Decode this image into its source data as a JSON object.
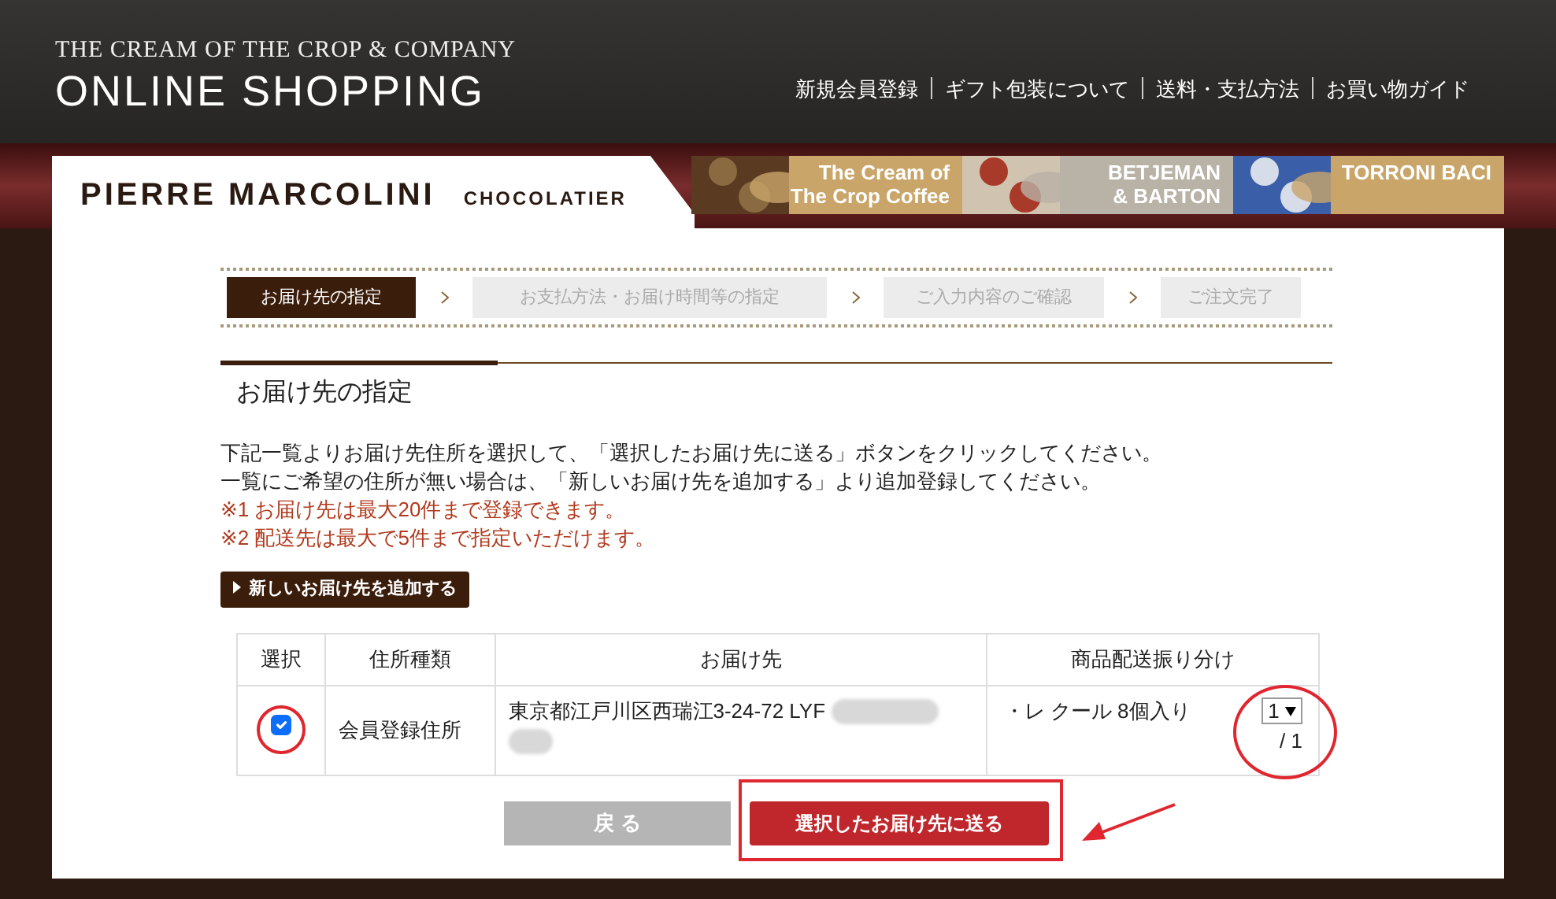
{
  "header": {
    "brand_line": "THE CREAM OF THE CROP & COMPANY",
    "title": "ONLINE SHOPPING",
    "nav": [
      "新規会員登録",
      "ギフト包装について",
      "送料・支払方法",
      "お買い物ガイド"
    ]
  },
  "banner": {
    "logo": "PIERRE MARCOLINI",
    "logo_sub": "CHOCOLATIER",
    "promos": [
      {
        "lines": [
          "The Cream of",
          "The Crop Coffee"
        ]
      },
      {
        "lines": [
          "BETJEMAN",
          "& BARTON"
        ]
      },
      {
        "lines": [
          "TORRONI BACI"
        ]
      }
    ]
  },
  "steps": [
    {
      "label": "お届け先の指定",
      "selected": true
    },
    {
      "label": "お支払方法・お届け時間等の指定",
      "selected": false
    },
    {
      "label": "ご入力内容のご確認",
      "selected": false
    },
    {
      "label": "ご注文完了",
      "selected": false
    }
  ],
  "section_title": "お届け先の指定",
  "instructions": [
    "下記一覧よりお届け先住所を選択して、「選択したお届け先に送る」ボタンをクリックしてください。",
    "一覧にご希望の住所が無い場合は、「新しいお届け先を追加する」より追加登録してください。"
  ],
  "notes": [
    "※1 お届け先は最大20件まで登録できます。",
    "※2 配送先は最大で5件まで指定いただけます。"
  ],
  "add_button": "新しいお届け先を追加する",
  "table": {
    "columns": [
      "選択",
      "住所種類",
      "お届け先",
      "商品配送振り分け"
    ],
    "rows": [
      {
        "selected": true,
        "address_type": "会員登録住所",
        "address": "東京都江戸川区西瑞江3-24-72 LYF",
        "item": "・レ クール 8個入り",
        "quantity": "1",
        "total": "/ 1"
      }
    ]
  },
  "buttons": {
    "back": "戻 る",
    "submit": "選択したお届け先に送る"
  }
}
